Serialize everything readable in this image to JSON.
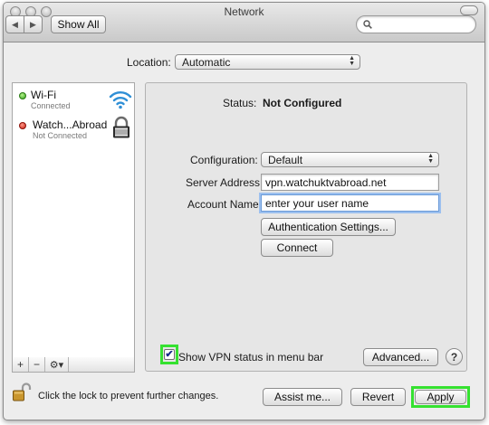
{
  "window": {
    "title": "Network"
  },
  "toolbar": {
    "back_glyph": "◀",
    "forward_glyph": "▶",
    "show_all_label": "Show All",
    "search_placeholder": ""
  },
  "location": {
    "label": "Location:",
    "value": "Automatic"
  },
  "services": [
    {
      "name": "Wi-Fi",
      "status": "Connected",
      "status_color": "#33a31a",
      "icon": "wifi-icon"
    },
    {
      "name": "Watch...Abroad",
      "status": "Not Connected",
      "status_color": "#c81e12",
      "icon": "lock-icon"
    }
  ],
  "sidebar_tools": {
    "add": "+",
    "remove": "−",
    "gear": "⚙▾"
  },
  "detail": {
    "status_label": "Status:",
    "status_value": "Not Configured",
    "configuration_label": "Configuration:",
    "configuration_value": "Default",
    "server_label": "Server Address:",
    "server_value": "vpn.watchuktvabroad.net",
    "account_label": "Account Name:",
    "account_value": "enter your user name",
    "auth_button": "Authentication Settings...",
    "connect_button": "Connect",
    "show_vpn_label": "Show VPN status in menu bar",
    "show_vpn_checked": true,
    "advanced_button": "Advanced...",
    "help_button": "?"
  },
  "footer": {
    "lock_text": "Click the lock to prevent further changes.",
    "assist_button": "Assist me...",
    "revert_button": "Revert",
    "apply_button": "Apply"
  },
  "colors": {
    "highlight": "#35e130",
    "focus_ring": "#9cc0ef"
  }
}
